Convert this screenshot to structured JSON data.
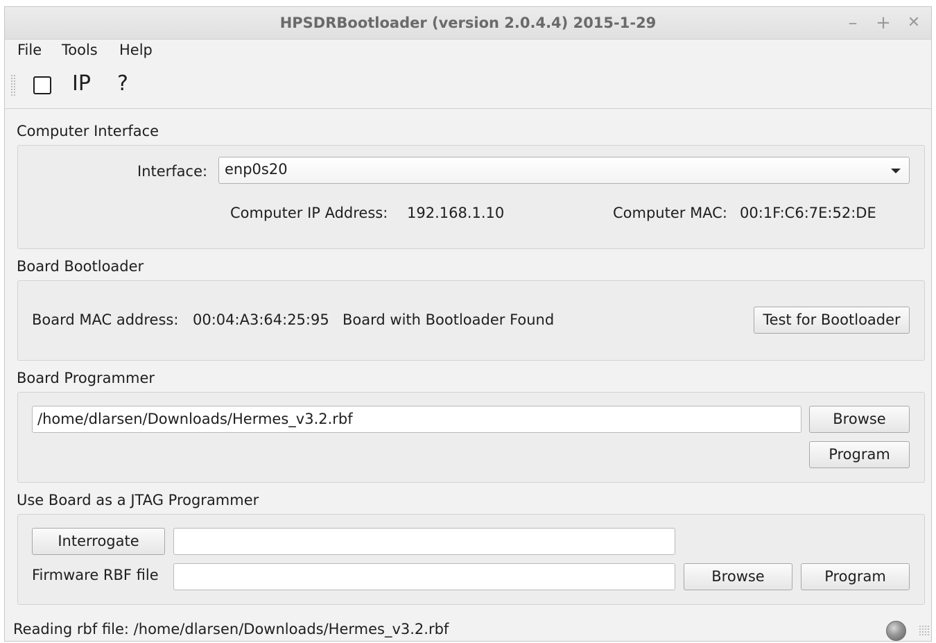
{
  "window": {
    "title": "HPSDRBootloader (version 2.0.4.4) 2015-1-29",
    "minimize_glyph": "–",
    "maximize_glyph": "+",
    "close_glyph": "✕"
  },
  "menu": {
    "items": [
      {
        "label": "File"
      },
      {
        "label": "Tools"
      },
      {
        "label": "Help"
      }
    ]
  },
  "toolbar": {
    "ip_label": "IP",
    "help_label": "?",
    "checkbox_checked": false
  },
  "computer_interface": {
    "section_label": "Computer Interface",
    "interface_label": "Interface:",
    "interface_value": "enp0s20",
    "ip_label": "Computer IP Address:",
    "ip_value": "192.168.1.10",
    "mac_label": "Computer MAC:",
    "mac_value": "00:1F:C6:7E:52:DE"
  },
  "board_bootloader": {
    "section_label": "Board Bootloader",
    "mac_label": "Board MAC address:",
    "mac_value": "00:04:A3:64:25:95",
    "status": "Board with Bootloader Found",
    "test_button": "Test for Bootloader"
  },
  "board_programmer": {
    "section_label": "Board Programmer",
    "file_path": "/home/dlarsen/Downloads/Hermes_v3.2.rbf",
    "browse_button": "Browse",
    "program_button": "Program"
  },
  "jtag": {
    "section_label": "Use Board as a JTAG Programmer",
    "interrogate_button": "Interrogate",
    "interrogate_value": "",
    "firmware_label": "Firmware RBF file",
    "firmware_value": "",
    "browse_button": "Browse",
    "program_button": "Program"
  },
  "status_bar": {
    "message": "Reading rbf file: /home/dlarsen/Downloads/Hermes_v3.2.rbf",
    "led_color": "#9a9a9a"
  }
}
